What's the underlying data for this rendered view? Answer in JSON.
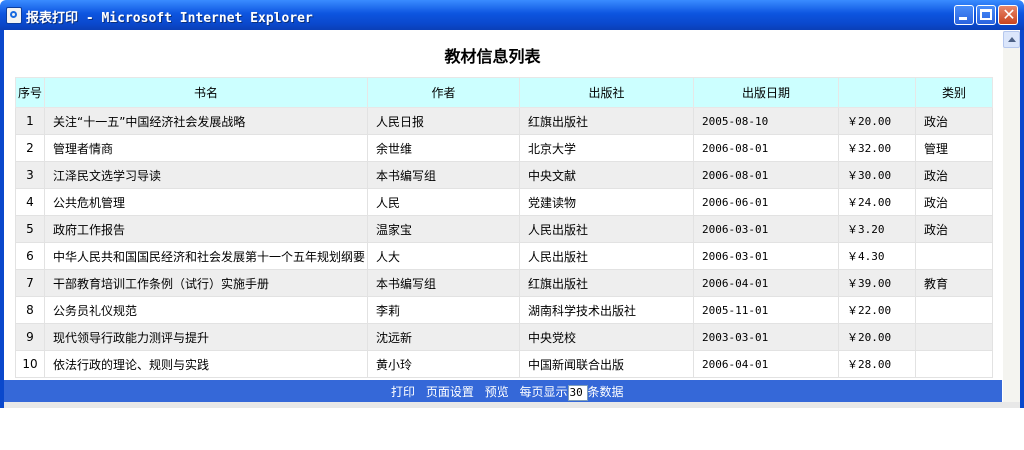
{
  "window": {
    "title": "报表打印 - Microsoft Internet Explorer",
    "accent_color": "#0a48cc",
    "controls": {
      "minimize_icon": "minimize-icon",
      "maximize_icon": "maximize-icon",
      "close_glyph": "✕"
    }
  },
  "report": {
    "title": "教材信息列表",
    "columns": [
      "序号",
      "书名",
      "作者",
      "出版社",
      "出版日期",
      "",
      "类别"
    ],
    "rows": [
      {
        "idx": "1",
        "name": "关注“十一五”中国经济社会发展战略",
        "author": "人民日报",
        "publisher": "红旗出版社",
        "date": "2005-08-10",
        "price": "￥20.00",
        "category": "政治"
      },
      {
        "idx": "2",
        "name": "管理者情商",
        "author": "余世维",
        "publisher": "北京大学",
        "date": "2006-08-01",
        "price": "￥32.00",
        "category": "管理"
      },
      {
        "idx": "3",
        "name": "江泽民文选学习导读",
        "author": "本书编写组",
        "publisher": "中央文献",
        "date": "2006-08-01",
        "price": "￥30.00",
        "category": "政治"
      },
      {
        "idx": "4",
        "name": "公共危机管理",
        "author": "人民",
        "publisher": "党建读物",
        "date": "2006-06-01",
        "price": "￥24.00",
        "category": "政治"
      },
      {
        "idx": "5",
        "name": "政府工作报告",
        "author": "温家宝",
        "publisher": "人民出版社",
        "date": "2006-03-01",
        "price": "￥3.20",
        "category": "政治"
      },
      {
        "idx": "6",
        "name": "中华人民共和国国民经济和社会发展第十一个五年规划纲要",
        "author": "人大",
        "publisher": "人民出版社",
        "date": "2006-03-01",
        "price": "￥4.30",
        "category": ""
      },
      {
        "idx": "7",
        "name": "干部教育培训工作条例（试行）实施手册",
        "author": "本书编写组",
        "publisher": "红旗出版社",
        "date": "2006-04-01",
        "price": "￥39.00",
        "category": "教育"
      },
      {
        "idx": "8",
        "name": "公务员礼仪规范",
        "author": "李莉",
        "publisher": "湖南科学技术出版社",
        "date": "2005-11-01",
        "price": "￥22.00",
        "category": ""
      },
      {
        "idx": "9",
        "name": "现代领导行政能力测评与提升",
        "author": "沈远新",
        "publisher": "中央党校",
        "date": "2003-03-01",
        "price": "￥20.00",
        "category": ""
      },
      {
        "idx": "10",
        "name": "依法行政的理论、规则与实践",
        "author": "黄小玲",
        "publisher": "中国新闻联合出版",
        "date": "2006-04-01",
        "price": "￥28.00",
        "category": ""
      }
    ]
  },
  "toolbar": {
    "print_label": "打印",
    "page_setup_label": "页面设置",
    "preview_label": "预览",
    "per_page_prefix": "每页显示",
    "per_page_value": "30",
    "per_page_suffix": "条数据",
    "background_color": "#3568d8"
  }
}
